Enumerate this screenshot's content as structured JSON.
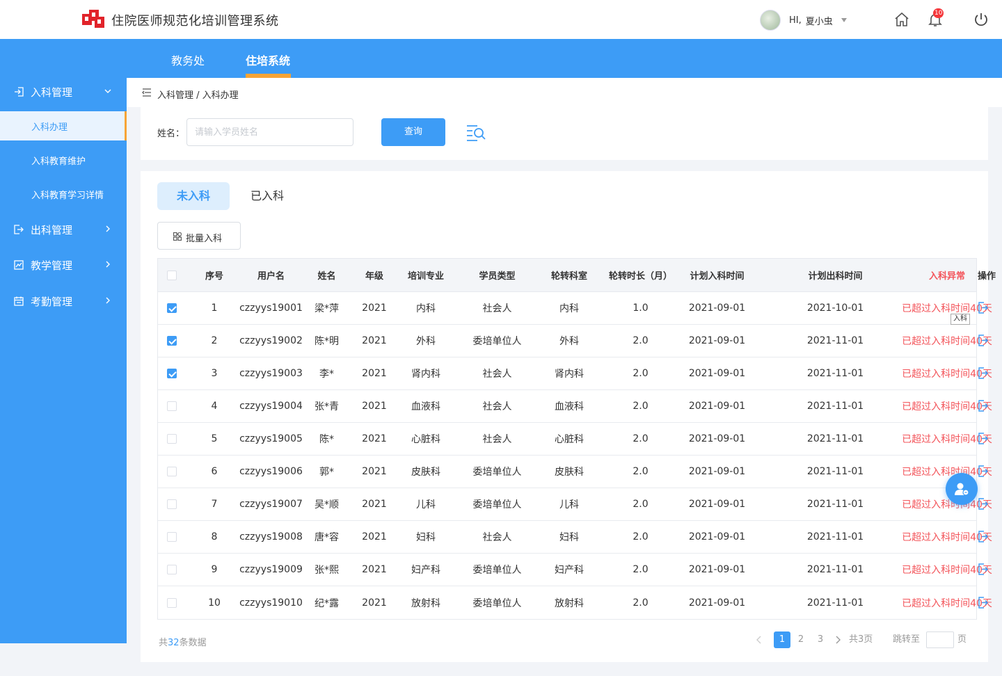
{
  "header": {
    "app_title": "住院医师规范化培训管理系统",
    "greeting": "HI,",
    "user_name": "夏小虫",
    "notification_count": "10"
  },
  "nav": {
    "tabs": [
      {
        "label": "教务处",
        "active": false
      },
      {
        "label": "住培系统",
        "active": true
      }
    ]
  },
  "sidebar": {
    "groups": [
      {
        "label": "入科管理",
        "icon": "login-icon",
        "expanded": true
      },
      {
        "label": "出科管理",
        "icon": "logout-icon",
        "expanded": false
      },
      {
        "label": "教学管理",
        "icon": "chart-icon",
        "expanded": false
      },
      {
        "label": "考勤管理",
        "icon": "calendar-icon",
        "expanded": false
      }
    ],
    "subitems": [
      {
        "label": "入科办理",
        "active": true
      },
      {
        "label": "入科教育维护",
        "active": false
      },
      {
        "label": "入科教育学习详情",
        "active": false
      }
    ]
  },
  "breadcrumb": "入科管理 / 入科办理",
  "search": {
    "label": "姓名：",
    "placeholder": "请输入学员姓名",
    "value": "",
    "button": "查询"
  },
  "tabs": {
    "active": "未入科",
    "inactive": "已入科"
  },
  "batch_button": "批量入科",
  "table": {
    "columns": [
      "序号",
      "用户名",
      "姓名",
      "年级",
      "培训专业",
      "学员类型",
      "轮转科室",
      "轮转时长（月）",
      "计划入科时间",
      "计划出科时间",
      "入科异常",
      "操作"
    ],
    "rows": [
      {
        "checked": true,
        "no": "1",
        "username": "czzyys19001",
        "name": "梁*萍",
        "grade": "2021",
        "major": "内科",
        "type": "社会人",
        "dept": "内科",
        "duration": "1.0",
        "plan_in": "2021-09-01",
        "plan_out": "2021-10-01",
        "abnormal": "已超过入科时间40天"
      },
      {
        "checked": true,
        "no": "2",
        "username": "czzyys19002",
        "name": "陈*明",
        "grade": "2021",
        "major": "外科",
        "type": "委培单位人",
        "dept": "外科",
        "duration": "2.0",
        "plan_in": "2021-09-01",
        "plan_out": "2021-11-01",
        "abnormal": "已超过入科时间40天"
      },
      {
        "checked": true,
        "no": "3",
        "username": "czzyys19003",
        "name": "李*",
        "grade": "2021",
        "major": "肾内科",
        "type": "社会人",
        "dept": "肾内科",
        "duration": "2.0",
        "plan_in": "2021-09-01",
        "plan_out": "2021-11-01",
        "abnormal": "已超过入科时间40天"
      },
      {
        "checked": false,
        "no": "4",
        "username": "czzyys19004",
        "name": "张*青",
        "grade": "2021",
        "major": "血液科",
        "type": "社会人",
        "dept": "血液科",
        "duration": "2.0",
        "plan_in": "2021-09-01",
        "plan_out": "2021-11-01",
        "abnormal": "已超过入科时间40天"
      },
      {
        "checked": false,
        "no": "5",
        "username": "czzyys19005",
        "name": "陈*",
        "grade": "2021",
        "major": "心脏科",
        "type": "社会人",
        "dept": "心脏科",
        "duration": "2.0",
        "plan_in": "2021-09-01",
        "plan_out": "2021-11-01",
        "abnormal": "已超过入科时间40天"
      },
      {
        "checked": false,
        "no": "6",
        "username": "czzyys19006",
        "name": "郭*",
        "grade": "2021",
        "major": "皮肤科",
        "type": "委培单位人",
        "dept": "皮肤科",
        "duration": "2.0",
        "plan_in": "2021-09-01",
        "plan_out": "2021-11-01",
        "abnormal": "已超过入科时间40天"
      },
      {
        "checked": false,
        "no": "7",
        "username": "czzyys19007",
        "name": "吴*顺",
        "grade": "2021",
        "major": "儿科",
        "type": "委培单位人",
        "dept": "儿科",
        "duration": "2.0",
        "plan_in": "2021-09-01",
        "plan_out": "2021-11-01",
        "abnormal": "已超过入科时间40天"
      },
      {
        "checked": false,
        "no": "8",
        "username": "czzyys19008",
        "name": "唐*容",
        "grade": "2021",
        "major": "妇科",
        "type": "社会人",
        "dept": "妇科",
        "duration": "2.0",
        "plan_in": "2021-09-01",
        "plan_out": "2021-11-01",
        "abnormal": "已超过入科时间40天"
      },
      {
        "checked": false,
        "no": "9",
        "username": "czzyys19009",
        "name": "张*熙",
        "grade": "2021",
        "major": "妇产科",
        "type": "委培单位人",
        "dept": "妇产科",
        "duration": "2.0",
        "plan_in": "2021-09-01",
        "plan_out": "2021-11-01",
        "abnormal": "已超过入科时间40天"
      },
      {
        "checked": false,
        "no": "10",
        "username": "czzyys19010",
        "name": "纪*露",
        "grade": "2021",
        "major": "放射科",
        "type": "委培单位人",
        "dept": "放射科",
        "duration": "2.0",
        "plan_in": "2021-09-01",
        "plan_out": "2021-11-01",
        "abnormal": "已超过入科时间40天"
      }
    ],
    "tooltip": "入科"
  },
  "pagination": {
    "total_prefix": "共",
    "total_count": "32",
    "total_suffix": "条数据",
    "pages": [
      "1",
      "2",
      "3"
    ],
    "current_page": "1",
    "page_count": "共3页",
    "jump_label": "跳转至",
    "jump_suffix": "页"
  },
  "colors": {
    "primary": "#3d9cf6",
    "accent": "#f7a436",
    "error": "#f3545a",
    "badge": "#f5363a"
  }
}
